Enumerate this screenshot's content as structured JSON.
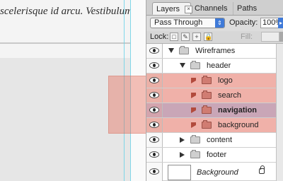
{
  "canvas": {
    "text": "scelerisque id arcu. Vestibulum"
  },
  "panel": {
    "tabs": [
      {
        "label": "Layers",
        "active": true
      },
      {
        "label": "Channels",
        "active": false
      },
      {
        "label": "Paths",
        "active": false
      }
    ],
    "blend_mode": "Pass Through",
    "opacity_label": "Opacity:",
    "opacity_value": "100%",
    "lock_label": "Lock:",
    "fill_label": "Fill:",
    "lock_icons": [
      "lock-transparent-icon",
      "lock-paint-icon",
      "lock-position-icon",
      "lock-all-icon"
    ],
    "layers": [
      {
        "name": "Wireframes",
        "expanded": true,
        "level": 0,
        "selected": false,
        "red": false
      },
      {
        "name": "header",
        "expanded": true,
        "level": 1,
        "selected": false,
        "red": false
      },
      {
        "name": "logo",
        "expanded": false,
        "level": 2,
        "selected": false,
        "red": true
      },
      {
        "name": "search",
        "expanded": false,
        "level": 2,
        "selected": false,
        "red": true
      },
      {
        "name": "navigation",
        "expanded": false,
        "level": 2,
        "selected": true,
        "red": true
      },
      {
        "name": "background",
        "expanded": false,
        "level": 2,
        "selected": false,
        "red": true
      },
      {
        "name": "content",
        "expanded": false,
        "level": 1,
        "selected": false,
        "red": false
      },
      {
        "name": "footer",
        "expanded": false,
        "level": 1,
        "selected": false,
        "red": false
      },
      {
        "name": "Background",
        "expanded": false,
        "level": 0,
        "selected": false,
        "red": false,
        "locked": true
      }
    ]
  },
  "colors": {
    "selection_overlay": "#e56450",
    "selected_row": "#c9a6b7",
    "red_row": "#f0b1a9",
    "accent_blue": "#3f7ad8"
  }
}
